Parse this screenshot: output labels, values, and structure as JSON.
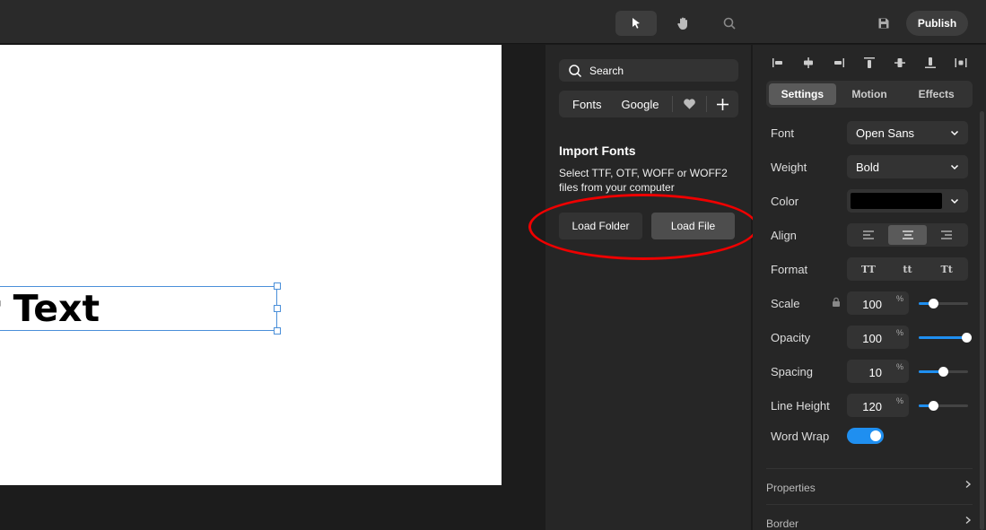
{
  "topbar": {
    "tools": [
      "select-tool",
      "hand-tool",
      "search-tool"
    ],
    "publish_label": "Publish"
  },
  "canvas": {
    "text_content": "ur Text"
  },
  "fonts_panel": {
    "search_placeholder": "Search",
    "tabs": [
      "Fonts",
      "Google"
    ],
    "import_title": "Import Fonts",
    "import_description": "Select TTF, OTF, WOFF or WOFF2 files from your computer",
    "load_folder_label": "Load Folder",
    "load_file_label": "Load File"
  },
  "properties": {
    "tabs": {
      "settings": "Settings",
      "motion": "Motion",
      "effects": "Effects"
    },
    "font_label": "Font",
    "font_value": "Open Sans",
    "weight_label": "Weight",
    "weight_value": "Bold",
    "color_label": "Color",
    "color_value": "#000000",
    "align_label": "Align",
    "align_selected": "center",
    "format_label": "Format",
    "format_options": [
      "TT",
      "tt",
      "Tt"
    ],
    "scale_label": "Scale",
    "scale_value": "100",
    "scale_fraction": 0.3,
    "opacity_label": "Opacity",
    "opacity_value": "100",
    "opacity_fraction": 1.0,
    "spacing_label": "Spacing",
    "spacing_value": "10",
    "spacing_fraction": 0.5,
    "line_height_label": "Line Height",
    "line_height_value": "120",
    "line_height_fraction": 0.3,
    "unit": "%",
    "word_wrap_label": "Word Wrap",
    "word_wrap_on": true,
    "sections": [
      "Properties",
      "Border"
    ]
  },
  "colors": {
    "accent": "#1f8ff0",
    "annotation": "#ee0000",
    "selection": "#4a8fd9"
  }
}
